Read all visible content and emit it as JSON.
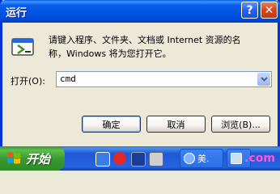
{
  "window": {
    "title": "运行",
    "help_label": "?",
    "close_label": "✕",
    "description": "请键入程序、文件夹、文档或 Internet 资源的名\n称，Windows 将为您打开它。",
    "open_label": "打开(O):",
    "open_value": "cmd",
    "ok_label": "确定",
    "cancel_label": "取消",
    "browse_label": "浏览(B)..."
  },
  "taskbar": {
    "start_label": "开始",
    "tasks": [
      {
        "label": "美."
      },
      {
        "label": ""
      }
    ],
    "watermark": ".com"
  },
  "colors": {
    "title_bar": "#0054e3",
    "start_button": "#3a9a30",
    "taskbar": "#2663e0"
  }
}
